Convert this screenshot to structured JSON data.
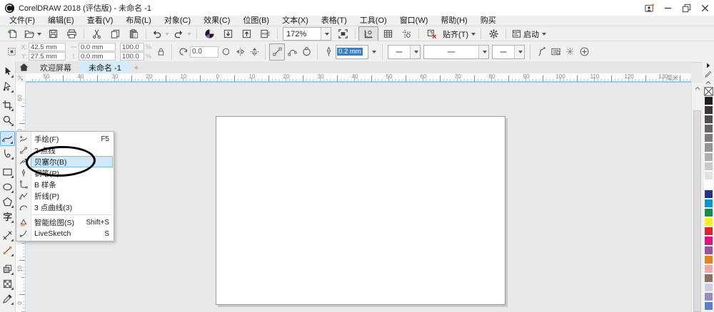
{
  "window": {
    "title": "CorelDRAW 2018 (评估版) - 未命名 -1",
    "controls": [
      "account",
      "minimize",
      "restore",
      "close"
    ]
  },
  "menu_bar": {
    "items": [
      {
        "name": "file",
        "label": "文件(F)"
      },
      {
        "name": "edit",
        "label": "编辑(E)"
      },
      {
        "name": "view",
        "label": "查看(V)"
      },
      {
        "name": "layout",
        "label": "布局(L)"
      },
      {
        "name": "object",
        "label": "对象(C)"
      },
      {
        "name": "effects",
        "label": "效果(C)"
      },
      {
        "name": "bitmaps",
        "label": "位图(B)"
      },
      {
        "name": "text",
        "label": "文本(X)"
      },
      {
        "name": "table",
        "label": "表格(T)"
      },
      {
        "name": "tools",
        "label": "工具(O)"
      },
      {
        "name": "window",
        "label": "窗口(W)"
      },
      {
        "name": "help",
        "label": "帮助(H)"
      },
      {
        "name": "buy",
        "label": "购买"
      }
    ]
  },
  "toolbar": {
    "zoom_value": "172%",
    "snap_label": "贴齐(T)",
    "launch_label": "启动",
    "items": [
      {
        "type": "btn",
        "icon": "new-doc",
        "name": "new-document"
      },
      {
        "type": "btn",
        "icon": "open",
        "name": "open",
        "dropdown": true
      },
      {
        "type": "btn",
        "icon": "save",
        "name": "save",
        "disabled": true
      },
      {
        "type": "btn",
        "icon": "print",
        "name": "print",
        "disabled": true
      },
      {
        "type": "sep"
      },
      {
        "type": "btn",
        "icon": "cut",
        "name": "cut",
        "disabled": true
      },
      {
        "type": "btn",
        "icon": "copy",
        "name": "copy",
        "disabled": true
      },
      {
        "type": "btn",
        "icon": "paste",
        "name": "paste"
      },
      {
        "type": "sep"
      },
      {
        "type": "btn",
        "icon": "undo",
        "name": "undo",
        "disabled": true,
        "dropdown": true
      },
      {
        "type": "btn",
        "icon": "redo",
        "name": "redo",
        "disabled": true,
        "dropdown": true
      },
      {
        "type": "sep"
      },
      {
        "type": "btn",
        "icon": "content",
        "name": "search-content"
      },
      {
        "type": "btn",
        "icon": "import",
        "name": "import"
      },
      {
        "type": "btn",
        "icon": "export",
        "name": "export",
        "disabled": true
      },
      {
        "type": "btn",
        "icon": "pdf",
        "name": "publish-to-pdf",
        "disabled": true
      },
      {
        "type": "sep"
      },
      {
        "type": "combo",
        "name": "zoom-level",
        "value": "172%"
      },
      {
        "type": "btn",
        "icon": "fit-page",
        "name": "full-screen-preview"
      },
      {
        "type": "sep"
      },
      {
        "type": "btn",
        "icon": "show-rulers",
        "name": "show-rulers",
        "pressed": true
      },
      {
        "type": "btn",
        "icon": "show-grid",
        "name": "show-grid"
      },
      {
        "type": "btn",
        "icon": "show-guides",
        "name": "show-guidelines"
      },
      {
        "type": "sep"
      },
      {
        "type": "btn",
        "icon": "snap-off",
        "name": "snap-disable"
      },
      {
        "type": "btn",
        "name": "snap-to",
        "label": "贴齐(T)",
        "dropdown": true
      },
      {
        "type": "sep"
      },
      {
        "type": "btn",
        "icon": "gear",
        "name": "options"
      },
      {
        "type": "sep"
      },
      {
        "type": "btn",
        "icon": "launch-win",
        "name": "launch",
        "label": "启动",
        "dropdown": true
      }
    ]
  },
  "property_bar": {
    "values": {
      "x_label": "X:",
      "x": "42.5 mm",
      "y_label": "Y:",
      "y": "27.5 mm",
      "w": "0.0 mm",
      "h": "0.0 mm",
      "scale_h": "100.0",
      "scale_v": "100.0",
      "percent": "%",
      "angle": "0.0",
      "outline_width": "0.2 mm"
    },
    "items": [
      {
        "type": "icon",
        "icon": "pos-grid",
        "name": "object-position"
      },
      {
        "type": "xy"
      },
      {
        "type": "wh"
      },
      {
        "type": "scale"
      },
      {
        "type": "icon",
        "icon": "lock",
        "name": "lock-ratio",
        "disabled": true
      },
      {
        "type": "sep"
      },
      {
        "type": "angle"
      },
      {
        "type": "icon",
        "icon": "circle-o",
        "name": "rotation-center",
        "disabled": true
      },
      {
        "type": "icon",
        "icon": "mirror-h",
        "name": "mirror-horizontal",
        "disabled": true
      },
      {
        "type": "icon",
        "icon": "mirror-v",
        "name": "mirror-vertical",
        "disabled": true
      },
      {
        "type": "sep"
      },
      {
        "type": "icon",
        "icon": "seg-line",
        "name": "line-segment",
        "pressed": true
      },
      {
        "type": "icon",
        "icon": "seg-arc",
        "name": "arc-segment"
      },
      {
        "type": "icon",
        "icon": "seg-close",
        "name": "close-curve"
      },
      {
        "type": "sep"
      },
      {
        "type": "icon",
        "icon": "nib",
        "name": "outline-width-icon"
      },
      {
        "type": "outline"
      },
      {
        "type": "sep"
      },
      {
        "type": "combo",
        "icon": "arrow-plain",
        "name": "start-arrowhead",
        "wide": false
      },
      {
        "type": "combo",
        "icon": "line-style",
        "name": "line-style",
        "wide": true
      },
      {
        "type": "combo",
        "icon": "arrow-plain",
        "name": "end-arrowhead",
        "wide": false
      },
      {
        "type": "sep"
      },
      {
        "type": "icon",
        "icon": "wrap-curve",
        "name": "wrap-paragraph-text",
        "disabled": true
      },
      {
        "type": "icon",
        "icon": "text-flow",
        "name": "text-wrap",
        "disabled": true
      },
      {
        "type": "icon",
        "icon": "border-grid",
        "name": "border-and-grid",
        "disabled": true
      },
      {
        "type": "icon",
        "icon": "plus-circle",
        "name": "quick-customize",
        "disabled": true
      }
    ]
  },
  "tabs": {
    "items": [
      {
        "name": "welcome",
        "label": "欢迎屏幕"
      },
      {
        "name": "untitled-1",
        "label": "未命名 -1",
        "active": true
      }
    ],
    "new_tab_label": "+"
  },
  "ruler": {
    "h_numbers": [
      "50",
      "40",
      "30",
      "20",
      "10",
      "0",
      "10",
      "20",
      "30",
      "40",
      "50",
      "60",
      "70",
      "80",
      "90",
      "100",
      "110",
      "120",
      "130"
    ],
    "v_numbers": [
      "60",
      "50",
      "40",
      "30",
      "20",
      "10",
      "0"
    ],
    "unit": "毫米"
  },
  "toolbox": {
    "tools": [
      {
        "name": "pick",
        "icon": "pick"
      },
      {
        "name": "shape",
        "icon": "shape"
      },
      {
        "name": "crop",
        "icon": "crop",
        "group_start": true
      },
      {
        "name": "zoom",
        "icon": "zoom-tool"
      },
      {
        "name": "freehand",
        "icon": "freehand",
        "active": true,
        "group_start": true
      },
      {
        "name": "artistic-media",
        "icon": "artistic"
      },
      {
        "name": "rectangle",
        "icon": "rect-tool",
        "group_start": true
      },
      {
        "name": "ellipse",
        "icon": "ellipse-tool"
      },
      {
        "name": "polygon",
        "icon": "polygon"
      },
      {
        "name": "text",
        "icon": "text-tool"
      },
      {
        "name": "dimension",
        "icon": "dimension",
        "group_start": true
      },
      {
        "name": "connector",
        "icon": "connector"
      },
      {
        "name": "drop-shadow",
        "icon": "dropshadow",
        "group_start": true
      },
      {
        "name": "transparency",
        "icon": "transparency"
      },
      {
        "name": "eyedropper",
        "icon": "eyedropper"
      }
    ]
  },
  "flyout_menu": {
    "items": [
      {
        "name": "freehand",
        "icon": "freehand-i",
        "label": "手绘(F)",
        "shortcut": "F5"
      },
      {
        "name": "2-point-line",
        "icon": "two-point",
        "label": "2 点线",
        "shortcut": ""
      },
      {
        "name": "bezier",
        "icon": "bezier-i",
        "label": "贝塞尔(B)",
        "shortcut": "",
        "selected": true
      },
      {
        "name": "pen",
        "icon": "pen-i",
        "label": "钢笔(P)",
        "shortcut": ""
      },
      {
        "name": "b-spline",
        "icon": "bspline",
        "label": "B 样条",
        "shortcut": ""
      },
      {
        "name": "polyline",
        "icon": "polyline",
        "label": "折线(P)",
        "shortcut": ""
      },
      {
        "name": "3-point-curve",
        "icon": "three-point",
        "label": "3 点曲线(3)",
        "shortcut": ""
      },
      {
        "name": "smart-drawing",
        "icon": "smart-draw",
        "label": "智能绘图(S)",
        "shortcut": "Shift+S",
        "separator_before": true
      },
      {
        "name": "livesketch",
        "icon": "livesketch",
        "label": "LiveSketch",
        "shortcut": "S"
      }
    ]
  },
  "palette": {
    "colors": [
      {
        "name": "black",
        "hex": "#221e1f"
      },
      {
        "name": "90-black",
        "hex": "#3d3638"
      },
      {
        "name": "80-black",
        "hex": "#524c4e"
      },
      {
        "name": "70-black",
        "hex": "#696465"
      },
      {
        "name": "60-black",
        "hex": "#7f7b7c"
      },
      {
        "name": "50-black",
        "hex": "#989495"
      },
      {
        "name": "40-black",
        "hex": "#b1aeaf"
      },
      {
        "name": "30-black",
        "hex": "#cac8c9"
      },
      {
        "name": "20-black",
        "hex": "#e3e2e2"
      },
      {
        "name": "white",
        "hex": "#ffffff"
      },
      {
        "name": "blue",
        "hex": "#24308f"
      },
      {
        "name": "cyan",
        "hex": "#0b93d5"
      },
      {
        "name": "green",
        "hex": "#0c9347"
      },
      {
        "name": "yellow",
        "hex": "#fcee21"
      },
      {
        "name": "red",
        "hex": "#ea1d2c"
      },
      {
        "name": "magenta",
        "hex": "#e50f7f"
      },
      {
        "name": "purple",
        "hex": "#a0509c"
      },
      {
        "name": "orange",
        "hex": "#ef7f1b"
      },
      {
        "name": "pink",
        "hex": "#f4a7a4"
      },
      {
        "name": "brown",
        "hex": "#8a7265"
      },
      {
        "name": "pale-lavender",
        "hex": "#cfcde6"
      },
      {
        "name": "lavender",
        "hex": "#958cc3"
      },
      {
        "name": "sky-blue",
        "hex": "#5b7fd0"
      }
    ]
  },
  "colors": {
    "selection_highlight": "#cfe8fb",
    "selection_border": "#7fbce6",
    "ruler_accent": "#8fcdee",
    "field_selection": "#2f7fd6",
    "annotation": "#000000"
  }
}
